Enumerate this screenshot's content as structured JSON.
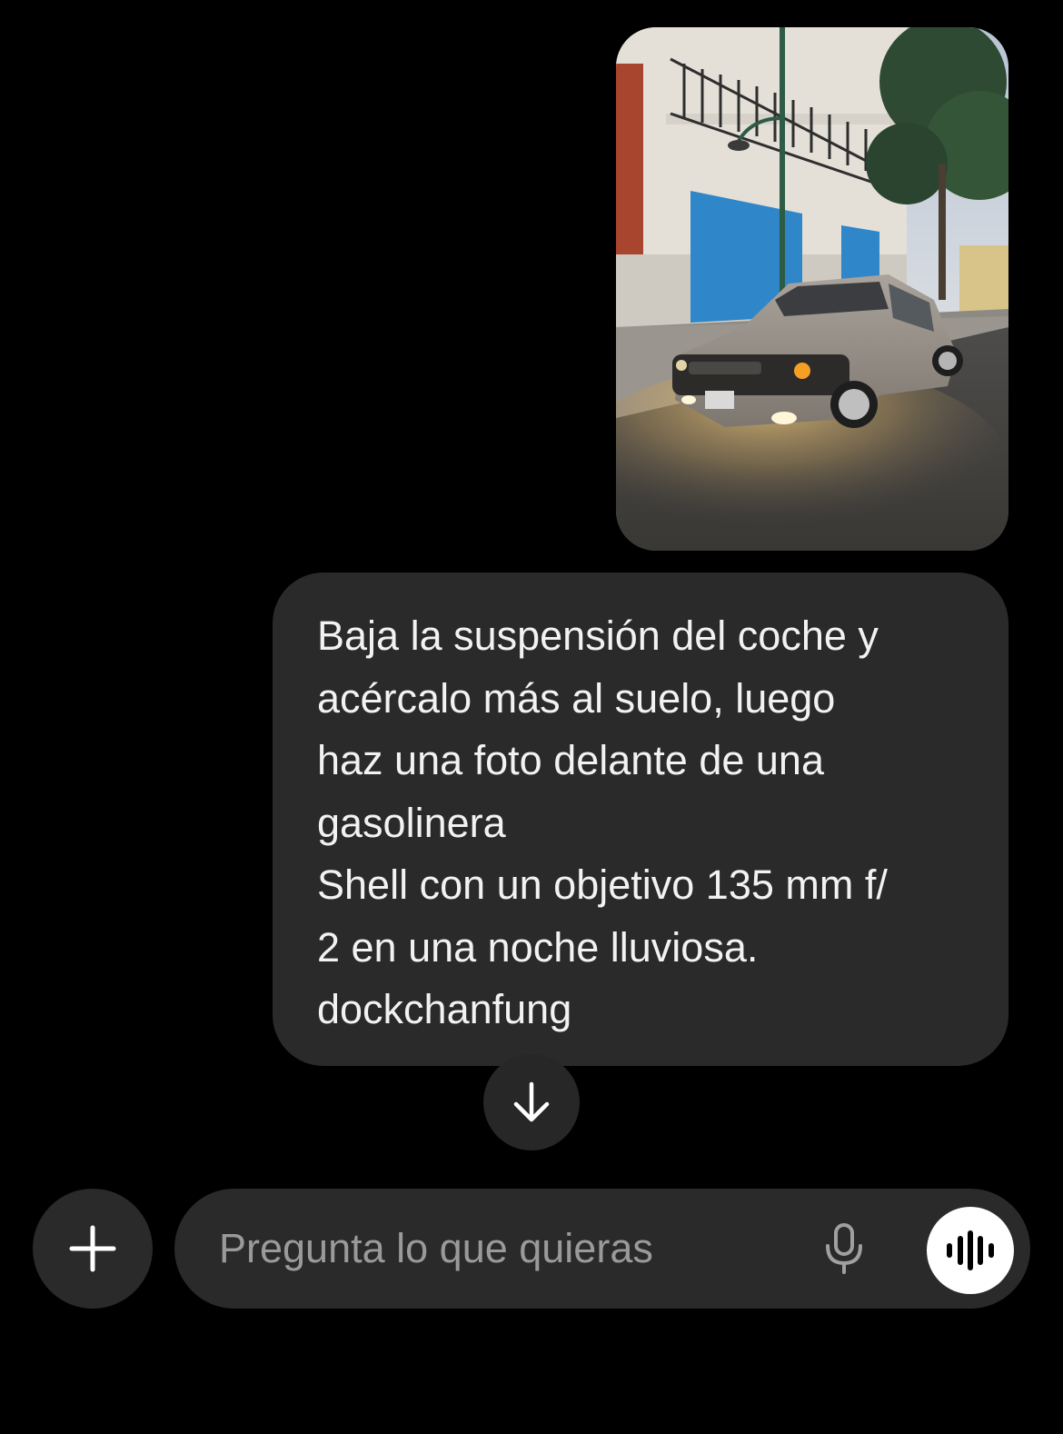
{
  "thread": {
    "image_message": {
      "icon": "photo-of-silver-hatchback-car-on-street"
    },
    "text_message": {
      "lines": [
        "Baja la suspensión del coche y",
        "acércalo más al suelo, luego",
        "haz una foto delante de una",
        "gasolinera",
        "Shell con un objetivo 135 mm f/",
        "2 en una noche lluviosa.",
        "dockchanfung"
      ]
    },
    "scroll_down": {
      "icon": "arrow-down-icon"
    }
  },
  "composer": {
    "input_value": "",
    "placeholder": "Pregunta lo que quieras",
    "add_icon": "plus-icon",
    "mic_icon": "microphone-icon",
    "voice_icon": "voice-waveform-icon"
  },
  "colors": {
    "background": "#000000",
    "bubble": "#2a2a2a",
    "text": "#f2f2f2",
    "placeholder": "#9a9a9a",
    "voice_button": "#ffffff"
  }
}
